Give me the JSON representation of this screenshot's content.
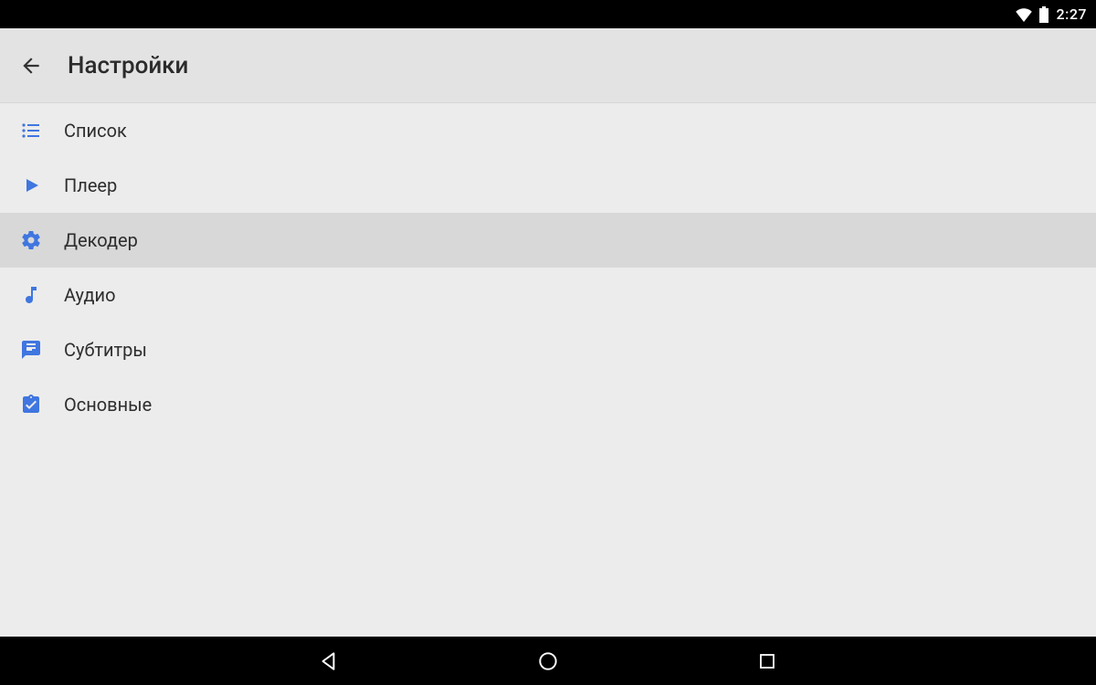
{
  "status": {
    "time": "2:27"
  },
  "toolbar": {
    "title": "Настройки"
  },
  "settings": {
    "items": [
      {
        "id": "list",
        "label": "Список",
        "icon": "list-icon",
        "selected": false
      },
      {
        "id": "player",
        "label": "Плеер",
        "icon": "play-icon",
        "selected": false
      },
      {
        "id": "decoder",
        "label": "Декодер",
        "icon": "gear-icon",
        "selected": true
      },
      {
        "id": "audio",
        "label": "Аудио",
        "icon": "music-icon",
        "selected": false
      },
      {
        "id": "subtitle",
        "label": "Субтитры",
        "icon": "subtitle-icon",
        "selected": false
      },
      {
        "id": "general",
        "label": "Основные",
        "icon": "clipboard-check-icon",
        "selected": false
      }
    ]
  },
  "colors": {
    "accent": "#3f76e0",
    "text": "#2e2e2e",
    "selectedBg": "#d8d8d8"
  }
}
